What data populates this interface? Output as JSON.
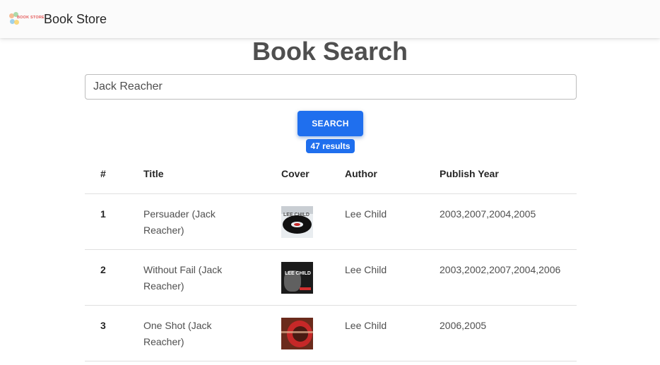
{
  "navbar": {
    "logo_text": "BOOK STORE",
    "brand": "Book Store"
  },
  "page": {
    "title": "Book Search"
  },
  "search": {
    "value": "Jack Reacher",
    "button_label": "SEARCH",
    "results_label": "47 results"
  },
  "table": {
    "headers": [
      "#",
      "Title",
      "Cover",
      "Author",
      "Publish Year"
    ],
    "rows": [
      {
        "num": "1",
        "title": "Persuader (Jack Reacher)",
        "cover_text": "LEE CHILD",
        "author": "Lee Child",
        "year": "2003,2007,2004,2005"
      },
      {
        "num": "2",
        "title": "Without Fail (Jack Reacher)",
        "cover_text": "LEE CHILD",
        "author": "Lee Child",
        "year": "2003,2002,2007,2004,2006"
      },
      {
        "num": "3",
        "title": "One Shot (Jack Reacher)",
        "cover_text": "",
        "author": "Lee Child",
        "year": "2006,2005"
      }
    ]
  },
  "colors": {
    "primary": "#1f6fee",
    "text": "#4f4f4f",
    "navbar_bg": "#fbfbfb"
  }
}
